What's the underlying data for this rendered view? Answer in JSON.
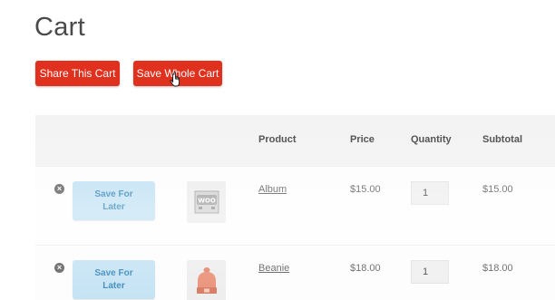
{
  "page": {
    "title": "Cart"
  },
  "actions": {
    "share_label": "Share This Cart",
    "save_whole_label": "Save Whole Cart",
    "accent_color": "#e0301e"
  },
  "table": {
    "headers": {
      "product": "Product",
      "price": "Price",
      "quantity": "Quantity",
      "subtotal": "Subtotal"
    },
    "rows": [
      {
        "save_for_later_line1": "Save For",
        "save_for_later_line2": "Later",
        "thumbnail_icon": "woo-album-icon",
        "product": "Album",
        "price": "$15.00",
        "quantity": "1",
        "subtotal": "$15.00"
      },
      {
        "save_for_later_line1": "Save For",
        "save_for_later_line2": "Later",
        "thumbnail_icon": "beanie-icon",
        "product": "Beanie",
        "price": "$18.00",
        "quantity": "1",
        "subtotal": "$18.00"
      }
    ]
  }
}
